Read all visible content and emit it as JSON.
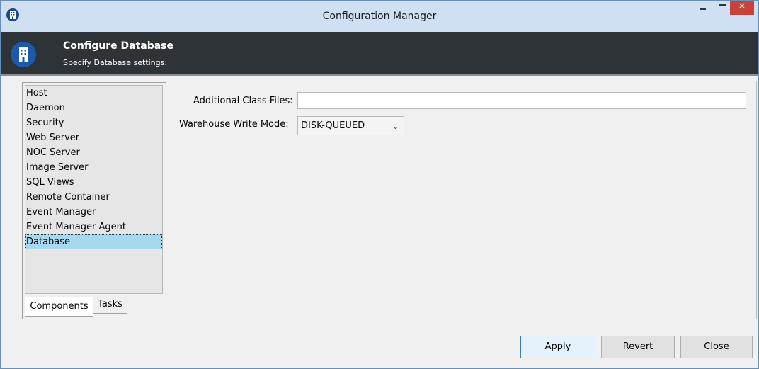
{
  "window": {
    "title": "Configuration Manager",
    "controls": {
      "minimize": "–",
      "maximize": "□",
      "close": "✕"
    }
  },
  "header": {
    "title": "Configure Database",
    "subtitle": "Specify Database settings:"
  },
  "sidebar": {
    "items": [
      {
        "label": "Host"
      },
      {
        "label": "Daemon"
      },
      {
        "label": "Security"
      },
      {
        "label": "Web Server"
      },
      {
        "label": "NOC Server"
      },
      {
        "label": "Image Server"
      },
      {
        "label": "SQL Views"
      },
      {
        "label": "Remote Container"
      },
      {
        "label": "Event Manager"
      },
      {
        "label": "Event Manager Agent"
      },
      {
        "label": "Database",
        "selected": true
      }
    ],
    "tabs": [
      {
        "label": "Components",
        "active": true
      },
      {
        "label": "Tasks"
      }
    ]
  },
  "form": {
    "additional_class_files_label": "Additional Class Files:",
    "additional_class_files_value": "",
    "warehouse_write_mode_label": "Warehouse Write Mode:",
    "warehouse_write_mode_value": "DISK-QUEUED"
  },
  "buttons": {
    "apply": "Apply",
    "revert": "Revert",
    "close": "Close"
  },
  "colors": {
    "header_bg": "#2e3338",
    "selection": "#a6d8f0",
    "close_button": "#c7423a",
    "brand_icon": "#1a5aa8"
  }
}
